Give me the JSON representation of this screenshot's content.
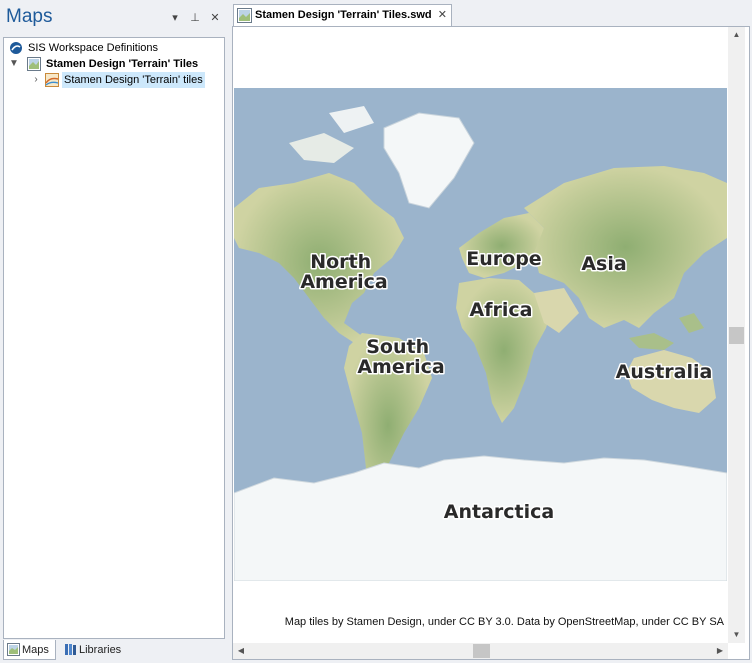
{
  "left_panel": {
    "title": "Maps",
    "controls": {
      "dropdown": "▾",
      "pin": "⊥",
      "close": "✕"
    },
    "tree": {
      "root": {
        "label": "SIS Workspace Definitions",
        "icon": "sis-workspace-icon"
      },
      "child": {
        "label": "Stamen Design 'Terrain' Tiles",
        "expanded": true,
        "icon": "map-definition-icon"
      },
      "grandchild": {
        "label": "Stamen Design 'Terrain' tiles",
        "selected": true,
        "icon": "tile-layer-icon"
      }
    },
    "bottom_tabs": [
      {
        "label": "Maps",
        "active": true,
        "icon": "maps-icon"
      },
      {
        "label": "Libraries",
        "active": false,
        "icon": "libraries-icon"
      }
    ]
  },
  "document": {
    "tab_label": "Stamen Design 'Terrain' Tiles.swd",
    "tab_close": "✕",
    "map": {
      "labels": [
        "North America",
        "Europe",
        "Asia",
        "Africa",
        "South America",
        "Australia",
        "Antarctica"
      ]
    },
    "attribution": "Map tiles by Stamen Design, under CC BY 3.0. Data by OpenStreetMap, under CC BY SA"
  },
  "scrollbars": {
    "up": "▲",
    "down": "▼",
    "left": "◀",
    "right": "▶"
  },
  "colors": {
    "ocean": "#9bb4cc",
    "land": "#d9d7ad",
    "vegetation": "#a9bf8a",
    "ice": "#f4f7f8",
    "accent": "#1e5a9a",
    "selection": "#cde8fb"
  }
}
